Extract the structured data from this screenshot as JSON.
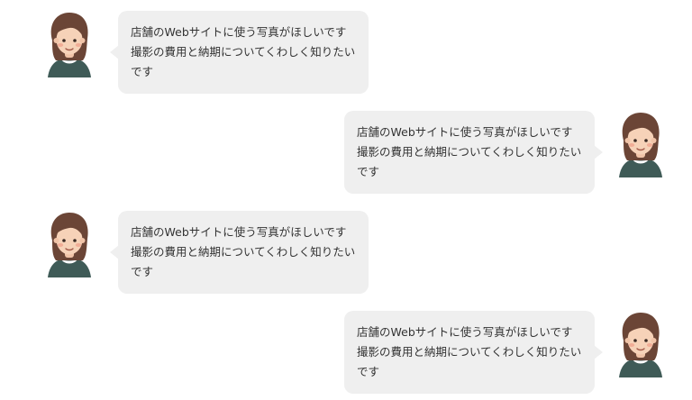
{
  "messages": [
    {
      "side": "left",
      "avatar": "woman-avatar-icon",
      "text": "店舗のWebサイトに使う写真がほしいです撮影の費用と納期についてくわしく知りたいです"
    },
    {
      "side": "right",
      "avatar": "woman-avatar-icon",
      "text": "店舗のWebサイトに使う写真がほしいです撮影の費用と納期についてくわしく知りたいです"
    },
    {
      "side": "left",
      "avatar": "woman-avatar-icon",
      "text": "店舗のWebサイトに使う写真がほしいです撮影の費用と納期についてくわしく知りたいです"
    },
    {
      "side": "right",
      "avatar": "woman-avatar-icon",
      "text": "店舗のWebサイトに使う写真がほしいです撮影の費用と納期についてくわしく知りたいです"
    }
  ],
  "colors": {
    "bubble": "#efefef",
    "text": "#333333",
    "hair": "#6b4536",
    "skin": "#f6d2b8",
    "shirt": "#3f5b57"
  }
}
